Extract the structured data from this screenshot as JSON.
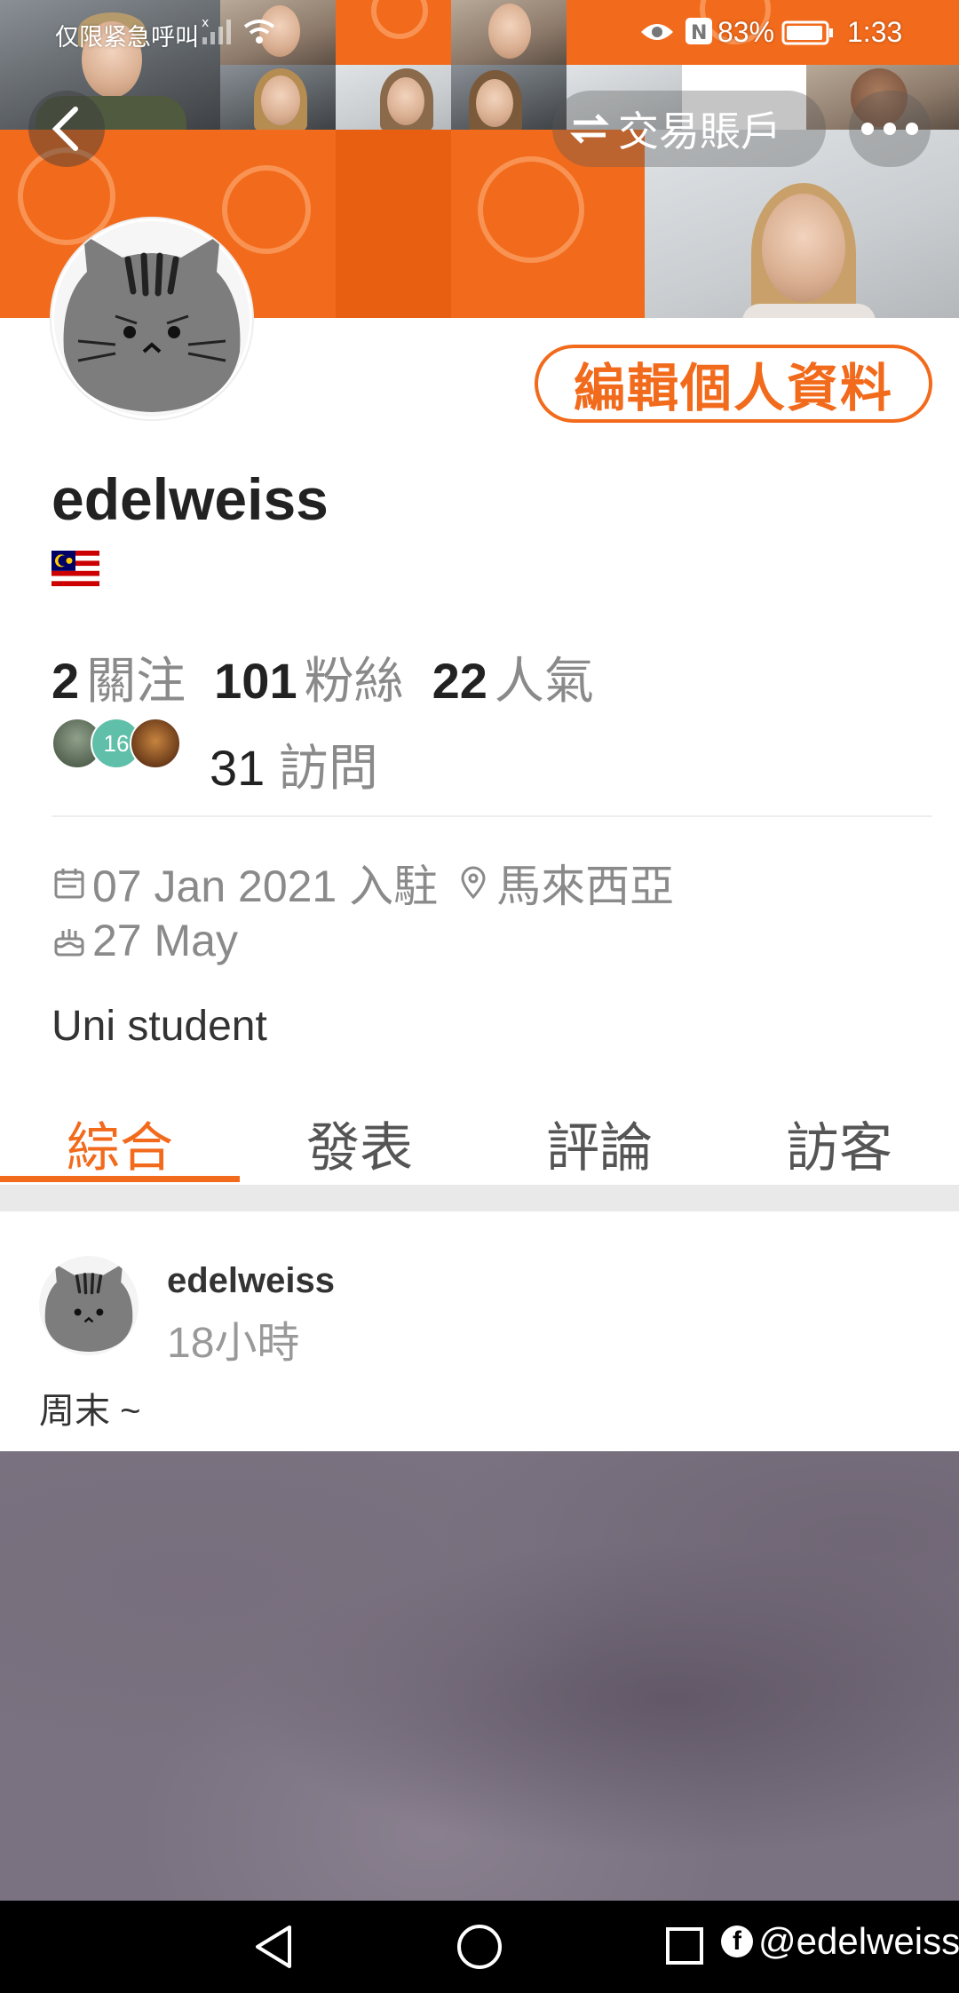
{
  "status_bar": {
    "carrier": "仅限紧急呼叫",
    "battery": "83%",
    "time": "1:33"
  },
  "header": {
    "switch_account_label": "交易賬戶",
    "edit_profile_label": "編輯個人資料"
  },
  "profile": {
    "username": "edelweiss",
    "country_flag": "malaysia-flag-icon",
    "stats": [
      {
        "value": "2",
        "label": "關注"
      },
      {
        "value": "101",
        "label": "粉絲"
      },
      {
        "value": "22",
        "label": "人氣"
      }
    ],
    "visitor_badge": "16",
    "visits": {
      "value": "31",
      "label": "訪問"
    },
    "joined": "07 Jan 2021 入駐",
    "location": "馬來西亞",
    "birthday": "27 May",
    "bio": "Uni student"
  },
  "tabs": [
    {
      "label": "綜合",
      "active": true
    },
    {
      "label": "發表",
      "active": false
    },
    {
      "label": "評論",
      "active": false
    },
    {
      "label": "訪客",
      "active": false
    }
  ],
  "post": {
    "author": "edelweiss",
    "time": "18小時",
    "text": "周末 ~"
  },
  "watermark": "@edelweiss",
  "colors": {
    "accent": "#f26a1b",
    "muted_text": "#8a8a8a"
  }
}
